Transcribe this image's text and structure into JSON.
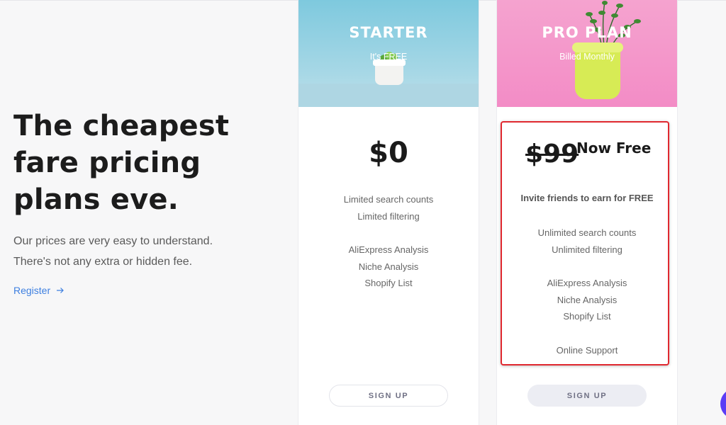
{
  "hero": {
    "title_lines": [
      "The cheapest",
      "fare pricing",
      "plans eve."
    ],
    "subtitle_lines": [
      "Our prices are very easy to understand.",
      "There's not any extra or hidden fee."
    ],
    "register_label": "Register",
    "register_icon": "arrow-right-icon"
  },
  "plans": [
    {
      "name": "STARTER",
      "note": "It's FREE",
      "price": "$0",
      "features_1": [
        "Limited search counts",
        "Limited filtering"
      ],
      "features_2": [
        "AliExpress Analysis",
        "Niche Analysis",
        "Shopify List"
      ],
      "signup_label": "SIGN UP"
    },
    {
      "name": "PRO PLAN",
      "note": "Billed Monthly",
      "old_price": "$99",
      "price_label": "Now Free",
      "invite": "Invite friends to earn for FREE",
      "features_1": [
        "Unlimited search counts",
        "Unlimited filtering"
      ],
      "features_2": [
        "AliExpress Analysis",
        "Niche Analysis",
        "Shopify List"
      ],
      "features_3": [
        "Online Support"
      ],
      "signup_label": "SIGN UP"
    }
  ],
  "colors": {
    "accent_link": "#3d7fe0",
    "highlight_border": "#e0282f",
    "chat_bubble": "#5b3df5"
  },
  "icons": {
    "chat": "chat-bubble-icon"
  }
}
